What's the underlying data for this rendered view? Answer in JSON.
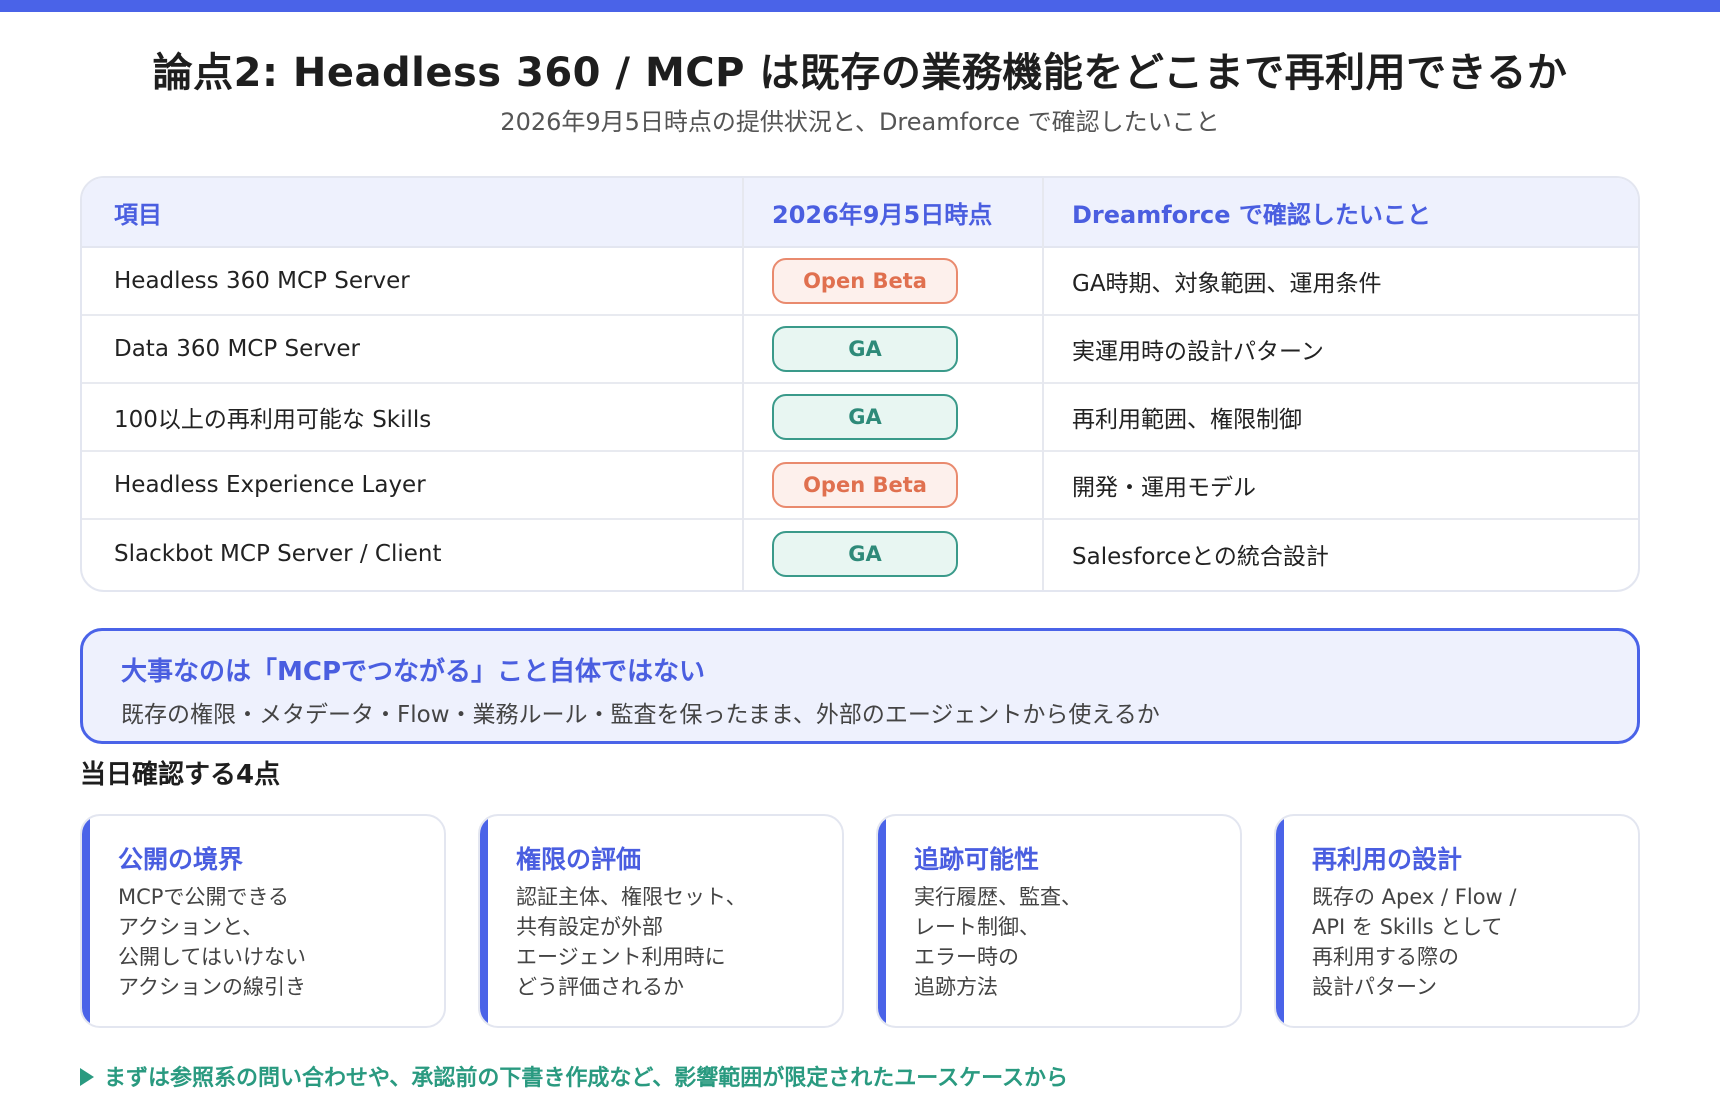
{
  "header": {
    "title": "論点2: Headless 360 / MCP は既存の業務機能をどこまで再利用できるか",
    "subtitle": "2026年9月5日時点の提供状況と、Dreamforce で確認したいこと"
  },
  "table": {
    "columns": [
      "項目",
      "2026年9月5日時点",
      "Dreamforce で確認したいこと"
    ],
    "rows": [
      {
        "item": "Headless 360 MCP Server",
        "status": "Open Beta",
        "status_type": "beta",
        "confirm": "GA時期、対象範囲、運用条件"
      },
      {
        "item": "Data 360 MCP Server",
        "status": "GA",
        "status_type": "ga",
        "confirm": "実運用時の設計パターン"
      },
      {
        "item": "100以上の再利用可能な Skills",
        "status": "GA",
        "status_type": "ga",
        "confirm": "再利用範囲、権限制御"
      },
      {
        "item": "Headless Experience Layer",
        "status": "Open Beta",
        "status_type": "beta",
        "confirm": "開発・運用モデル"
      },
      {
        "item": "Slackbot MCP Server / Client",
        "status": "GA",
        "status_type": "ga",
        "confirm": "Salesforceとの統合設計"
      }
    ]
  },
  "callout": {
    "title": "大事なのは「MCPでつながる」こと自体ではない",
    "body": "既存の権限・メタデータ・Flow・業務ルール・監査を保ったまま、外部のエージェントから使えるか"
  },
  "points_section": {
    "label": "当日確認する4点",
    "cards": [
      {
        "title": "公開の境界",
        "lines": [
          "MCPで公開できる",
          "アクションと、",
          "公開してはいけない",
          "アクションの線引き"
        ]
      },
      {
        "title": "権限の評価",
        "lines": [
          "認証主体、権限セット、",
          "共有設定が外部",
          "エージェント利用時に",
          "どう評価されるか"
        ]
      },
      {
        "title": "追跡可能性",
        "lines": [
          "実行履歴、監査、",
          "レート制御、",
          "エラー時の",
          "追跡方法"
        ]
      },
      {
        "title": "再利用の設計",
        "lines": [
          "既存の Apex / Flow /",
          "API を Skills として",
          "再利用する際の",
          "設計パターン"
        ]
      }
    ]
  },
  "footer": {
    "text": "まずは参照系の問い合わせや、承認前の下書き作成など、影響範囲が限定されたユースケースから"
  },
  "colors": {
    "accent": "#4a63e8",
    "beta": "#e0704f",
    "ga": "#2e8a79",
    "footer": "#2a9a80"
  }
}
